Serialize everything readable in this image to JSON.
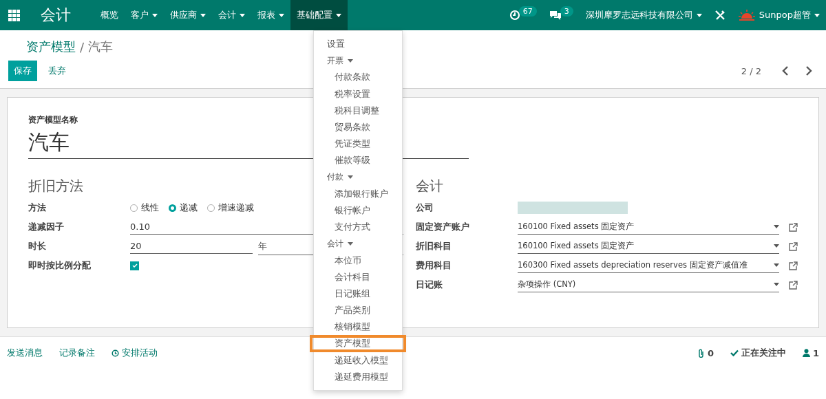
{
  "navbar": {
    "app_title": "会计",
    "menus": [
      {
        "label": "概览",
        "has_caret": false,
        "selected": false
      },
      {
        "label": "客户",
        "has_caret": true,
        "selected": false
      },
      {
        "label": "供应商",
        "has_caret": true,
        "selected": false
      },
      {
        "label": "会计",
        "has_caret": true,
        "selected": false
      },
      {
        "label": "报表",
        "has_caret": true,
        "selected": false
      },
      {
        "label": "基础配置",
        "has_caret": true,
        "selected": true
      }
    ],
    "activity_count": "67",
    "message_count": "3",
    "company": "深圳摩罗志远科技有限公司",
    "user": "Sunpop超管"
  },
  "breadcrumb": {
    "parent": "资产模型",
    "separator": "/",
    "current": "汽车"
  },
  "buttons": {
    "save": "保存",
    "discard": "丢弃"
  },
  "pager": "2 / 2",
  "form": {
    "name_label": "资产模型名称",
    "name": "汽车",
    "depreciation": {
      "title": "折旧方法",
      "method_label": "方法",
      "methods": [
        {
          "label": "线性",
          "selected": false
        },
        {
          "label": "递减",
          "selected": true
        },
        {
          "label": "增速递减",
          "selected": false
        }
      ],
      "factor_label": "递减因子",
      "factor": "0.10",
      "duration_label": "时长",
      "duration": "20",
      "duration_unit": "年",
      "prorata_label": "即时按比例分配",
      "prorata": true
    },
    "accounting": {
      "title": "会计",
      "company_label": "公司",
      "fields": [
        {
          "label": "固定资产账户",
          "value": "160100 Fixed assets 固定资产"
        },
        {
          "label": "折旧科目",
          "value": "160100 Fixed assets 固定资产"
        },
        {
          "label": "费用科目",
          "value": "160300 Fixed assets depreciation reserves 固定资产减值准"
        },
        {
          "label": "日记账",
          "value": "杂项操作 (CNY)"
        }
      ]
    }
  },
  "chatter": {
    "send_message": "发送消息",
    "log_note": "记录备注",
    "schedule": "安排活动",
    "attachments": "0",
    "following": "正在关注中",
    "followers": "1"
  },
  "dropdown": [
    {
      "label": "设置",
      "highlighted": false
    },
    {
      "label": "开票",
      "highlighted": false,
      "children": [
        {
          "label": "付款条款",
          "highlighted": false
        },
        {
          "label": "税率设置",
          "highlighted": false
        },
        {
          "label": "税科目调整",
          "highlighted": false
        },
        {
          "label": "贸易条款",
          "highlighted": false
        },
        {
          "label": "凭证类型",
          "highlighted": false
        },
        {
          "label": "催款等级",
          "highlighted": false
        }
      ]
    },
    {
      "label": "付款",
      "highlighted": false,
      "children": [
        {
          "label": "添加银行账户",
          "highlighted": false
        },
        {
          "label": "银行帐户",
          "highlighted": false
        },
        {
          "label": "支付方式",
          "highlighted": false
        }
      ]
    },
    {
      "label": "会计",
      "highlighted": false,
      "children": [
        {
          "label": "本位币",
          "highlighted": false
        },
        {
          "label": "会计科目",
          "highlighted": false
        },
        {
          "label": "日记账组",
          "highlighted": false
        },
        {
          "label": "产品类别",
          "highlighted": false
        },
        {
          "label": "核销模型",
          "highlighted": false
        },
        {
          "label": "资产模型",
          "highlighted": true
        },
        {
          "label": "递延收入模型",
          "highlighted": false
        },
        {
          "label": "递延费用模型",
          "highlighted": false
        }
      ]
    }
  ]
}
